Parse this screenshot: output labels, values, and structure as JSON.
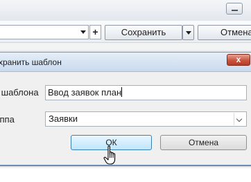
{
  "toolbar": {
    "plus_label": "+",
    "save_label": "Сохранить",
    "cancel_label": "Отмена"
  },
  "dialog": {
    "title": "хранить шаблон",
    "close_label": "x",
    "fields": {
      "name_label": "я шаблона",
      "name_value": "Ввод заявок план",
      "group_label": "уппа",
      "group_value": "Заявки"
    },
    "buttons": {
      "ok_label": "ОК",
      "cancel_label": "Отмена"
    }
  },
  "icons": {
    "combo_arrow": "chevron-down-icon",
    "save_dropdown": "caret-down-icon",
    "select_arrow": "chevron-down-icon",
    "cursor": "hand-pointer-icon"
  }
}
